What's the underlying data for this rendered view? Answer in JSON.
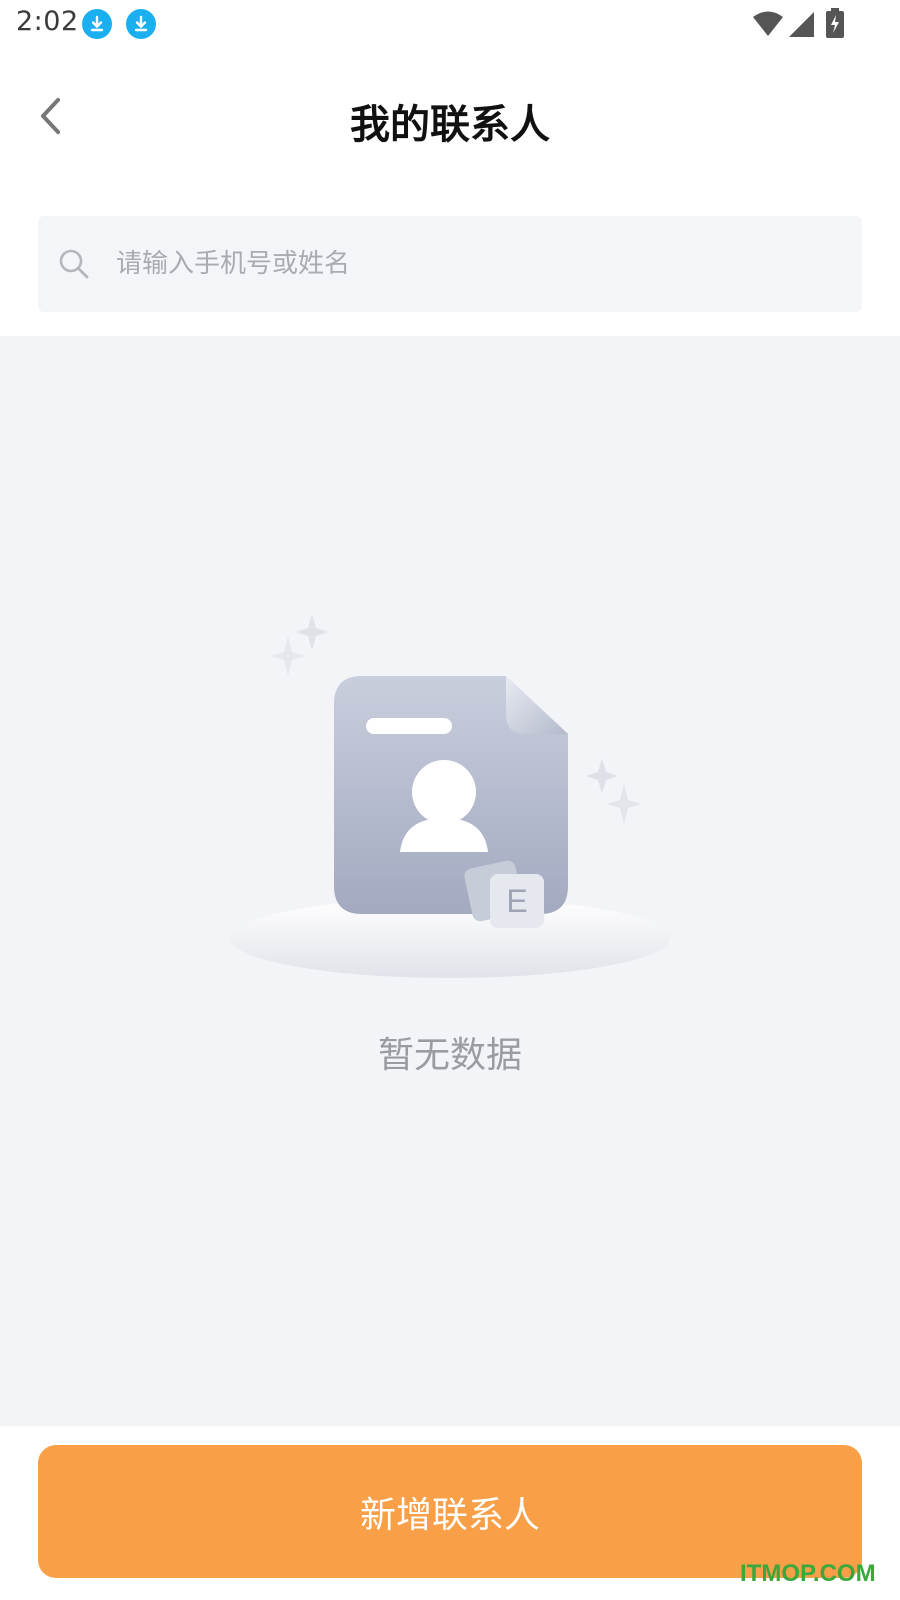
{
  "status_bar": {
    "time": "2:02",
    "icons": [
      "download-notification-icon",
      "download-notification-icon",
      "wifi-icon",
      "signal-icon",
      "battery-charging-icon"
    ],
    "notification_color": "#1ab0f0"
  },
  "header": {
    "title": "我的联系人",
    "back_icon": "chevron-left-icon"
  },
  "search": {
    "placeholder": "请输入手机号或姓名",
    "value": "",
    "icon": "search-icon"
  },
  "empty_state": {
    "illustration": "contact-card-empty-icon",
    "badge_letter": "E",
    "message": "暂无数据"
  },
  "footer": {
    "add_button_label": "新增联系人",
    "accent_color": "#f89f47"
  },
  "watermark": "ITMOP.COM"
}
